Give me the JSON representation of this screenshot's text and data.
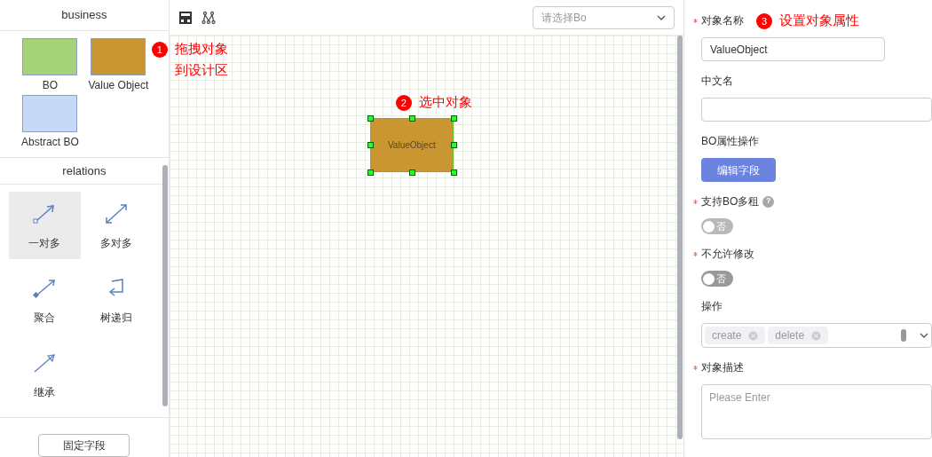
{
  "palette": {
    "business": {
      "title": "business",
      "items": [
        {
          "label": "BO",
          "color": "#a6d27a"
        },
        {
          "label": "Value Object",
          "color": "#c99631"
        },
        {
          "label": "Abstract BO",
          "color": "#c6daf8"
        }
      ]
    },
    "relations": {
      "title": "relations",
      "items": [
        {
          "label": "一对多",
          "kind": "one-to-many",
          "selected": true
        },
        {
          "label": "多对多",
          "kind": "many-to-many",
          "selected": false
        },
        {
          "label": "聚合",
          "kind": "aggregation",
          "selected": false
        },
        {
          "label": "树递归",
          "kind": "recursive",
          "selected": false
        },
        {
          "label": "继承",
          "kind": "inheritance",
          "selected": false
        }
      ]
    },
    "footer_button": "固定字段"
  },
  "canvas": {
    "select": {
      "placeholder": "请选择Bo"
    },
    "node": {
      "label": "ValueObject",
      "color": "#c99631",
      "selected": true
    }
  },
  "callouts": [
    {
      "number": "1",
      "lines": [
        "拖拽对象",
        "到设计区"
      ]
    },
    {
      "number": "2",
      "lines": [
        "选中对象"
      ]
    },
    {
      "number": "3",
      "lines": [
        "设置对象属性"
      ]
    }
  ],
  "properties": {
    "fields": [
      {
        "kind": "input",
        "label": "对象名称",
        "required": true,
        "value": "ValueObject"
      },
      {
        "kind": "input",
        "label": "中文名",
        "required": false
      },
      {
        "kind": "button",
        "label": "BO属性操作",
        "required": false,
        "button": "编辑字段"
      },
      {
        "kind": "toggle",
        "label": "支持BO多租",
        "required": true,
        "help": "?",
        "on": false,
        "disabled": true,
        "text": "否"
      },
      {
        "kind": "toggle",
        "label": "不允许修改",
        "required": true,
        "on": false,
        "disabled": false,
        "text": "否"
      },
      {
        "kind": "tags",
        "label": "操作",
        "required": false,
        "tags": [
          "create",
          "delete"
        ]
      },
      {
        "kind": "textarea",
        "label": "对象描述",
        "required": true,
        "placeholder": "Please Enter"
      }
    ]
  }
}
